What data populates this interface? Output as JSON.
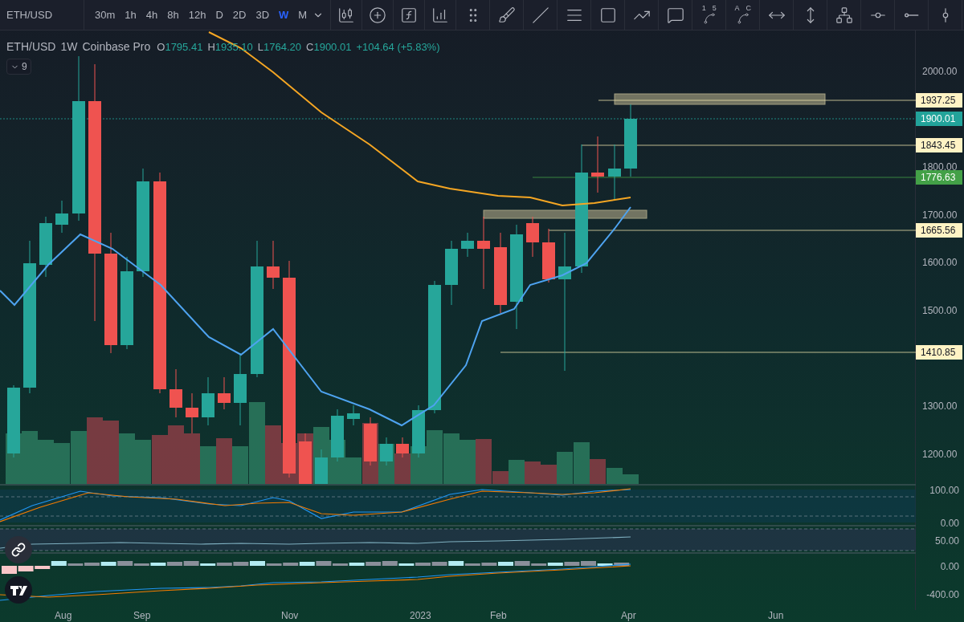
{
  "toolbar": {
    "symbol": "ETH/USD",
    "intervals": [
      {
        "label": "30m",
        "selected": false
      },
      {
        "label": "1h",
        "selected": false
      },
      {
        "label": "4h",
        "selected": false
      },
      {
        "label": "8h",
        "selected": false
      },
      {
        "label": "12h",
        "selected": false
      },
      {
        "label": "D",
        "selected": false
      },
      {
        "label": "2D",
        "selected": false
      },
      {
        "label": "3D",
        "selected": false
      },
      {
        "label": "W",
        "selected": true
      },
      {
        "label": "M",
        "selected": false
      }
    ],
    "tool_marks": [
      [
        "1",
        "5"
      ],
      [
        "A",
        "C"
      ]
    ]
  },
  "legend": {
    "symbol": "ETH/USD",
    "interval": "1W",
    "exchange": "Coinbase Pro",
    "ohlc": [
      {
        "label": "O",
        "value": "1795.41"
      },
      {
        "label": "H",
        "value": "1935.10"
      },
      {
        "label": "L",
        "value": "1764.20"
      },
      {
        "label": "C",
        "value": "1900.01"
      }
    ],
    "change": "+104.64 (+5.83%)",
    "indicators_count": "9"
  },
  "price_axis": {
    "ticks": [
      "2000.00",
      "1800.00",
      "1700.00",
      "1600.00",
      "1500.00",
      "1300.00",
      "1200.00"
    ],
    "labels": [
      {
        "value": "1937.25",
        "kind": "line"
      },
      {
        "value": "1900.01",
        "kind": "last"
      },
      {
        "value": "1843.45",
        "kind": "line"
      },
      {
        "value": "1776.63",
        "kind": "alert"
      },
      {
        "value": "1665.56",
        "kind": "line"
      },
      {
        "value": "1410.85",
        "kind": "line"
      }
    ]
  },
  "panes": [
    {
      "ticks": [
        "100.00",
        "0.00"
      ]
    },
    {
      "ticks": [
        "50.00"
      ]
    },
    {
      "ticks": [
        "0.00",
        "-400.00"
      ]
    }
  ],
  "time_axis": [
    "Aug",
    "Sep",
    "Nov",
    "2023",
    "Feb",
    "Apr",
    "Jun"
  ]
}
